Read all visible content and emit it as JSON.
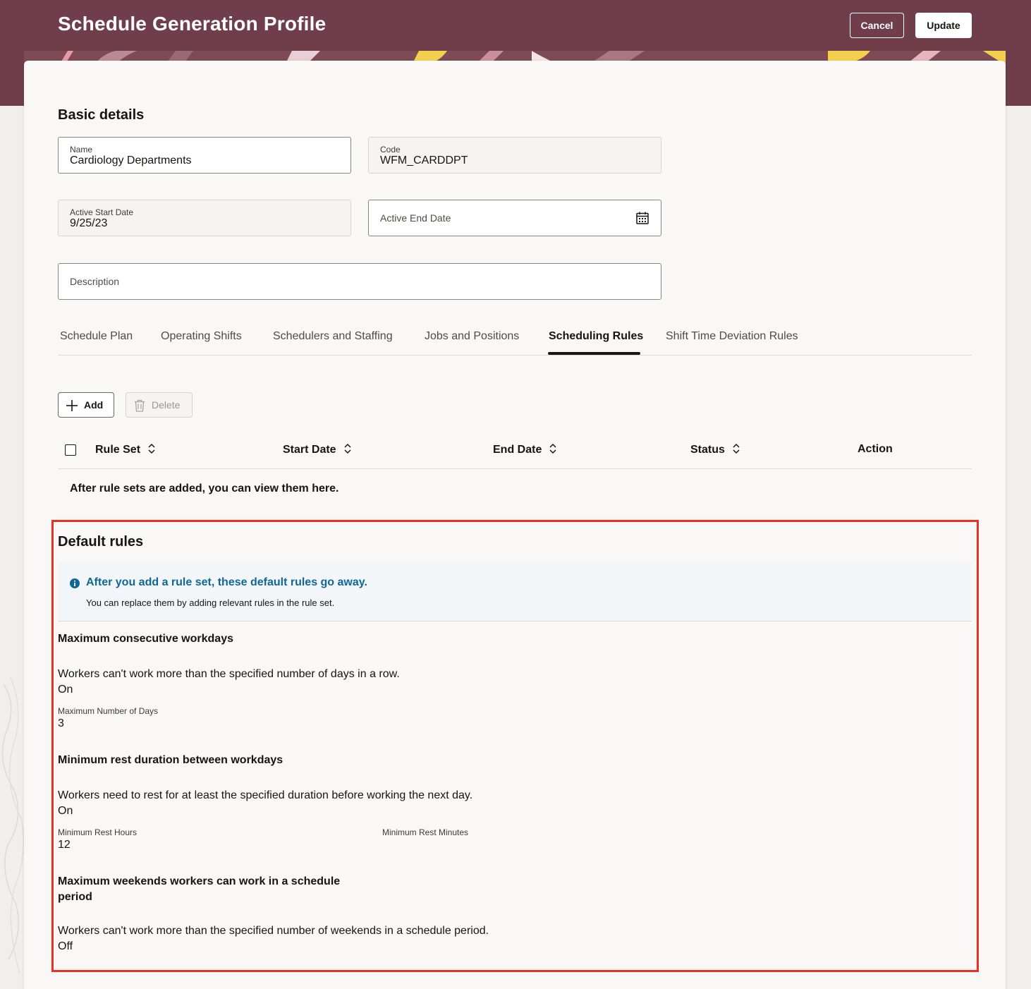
{
  "header": {
    "title": "Schedule Generation Profile",
    "cancel_label": "Cancel",
    "update_label": "Update"
  },
  "basic_details": {
    "title": "Basic details",
    "name": {
      "label": "Name",
      "value": "Cardiology Departments"
    },
    "code": {
      "label": "Code",
      "value": "WFM_CARDDPT"
    },
    "active_start_date": {
      "label": "Active Start Date",
      "value": "9/25/23"
    },
    "active_end_date": {
      "placeholder": "Active End Date"
    },
    "description": {
      "placeholder": "Description"
    }
  },
  "tabs": [
    {
      "label": "Schedule Plan"
    },
    {
      "label": "Operating Shifts"
    },
    {
      "label": "Schedulers and Staffing"
    },
    {
      "label": "Jobs and Positions"
    },
    {
      "label": "Scheduling Rules",
      "active": true
    },
    {
      "label": "Shift Time Deviation Rules"
    }
  ],
  "toolbar": {
    "add_label": "Add",
    "delete_label": "Delete"
  },
  "table": {
    "columns": [
      "Rule Set",
      "Start Date",
      "End Date",
      "Status",
      "Action"
    ],
    "empty_message": "After rule sets are added, you can view them here."
  },
  "default_rules": {
    "title": "Default rules",
    "info": {
      "heading": "After you add a rule set, these default rules go away.",
      "text": "You can replace them by adding relevant rules in the rule set."
    },
    "rules": [
      {
        "title": "Maximum consecutive workdays",
        "description": "Workers can't work more than the specified number of days in a row.",
        "state": "On",
        "fields": [
          {
            "label": "Maximum Number of Days",
            "value": "3"
          }
        ]
      },
      {
        "title": "Minimum rest duration between workdays",
        "description": "Workers need to rest for at least the specified duration before working the next day.",
        "state": "On",
        "fields": [
          {
            "label": "Minimum Rest Hours",
            "value": "12"
          },
          {
            "label": "Minimum Rest Minutes",
            "value": ""
          }
        ]
      },
      {
        "title_line1": "Maximum weekends workers can work in a schedule",
        "title_line2": "period",
        "description": "Workers can't work more than the specified number of weekends in a schedule period.",
        "state": "Off"
      }
    ]
  },
  "colors": {
    "header_bg": "#6f3e4a",
    "info_text": "#0f6795",
    "highlight": "#e8311f"
  }
}
